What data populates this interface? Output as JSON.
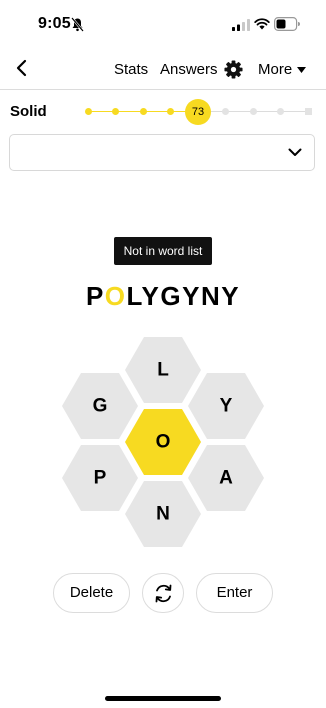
{
  "status_bar": {
    "time": "9:05",
    "icons": [
      "bell-muted-icon",
      "signal-icon",
      "wifi-icon",
      "battery-icon"
    ]
  },
  "nav": {
    "back_icon": "back-icon",
    "stats_label": "Stats",
    "answers_label": "Answers",
    "settings_icon": "gear-icon",
    "more_label": "More",
    "more_icon": "caret-down-icon"
  },
  "progress": {
    "rank": "Solid",
    "score": "73",
    "steps_total": 9,
    "steps_reached": 5,
    "fraction": 0.5
  },
  "word_list": {
    "value": "",
    "toggle_icon": "chevron-down-icon"
  },
  "toast": {
    "message": "Not in word list"
  },
  "input_word": {
    "text": "POLYGYNY",
    "center_letter": "O"
  },
  "hive": {
    "center": "O",
    "top": "L",
    "upper_left": "G",
    "upper_right": "Y",
    "lower_left": "P",
    "lower_right": "A",
    "bottom": "N"
  },
  "actions": {
    "delete_label": "Delete",
    "shuffle_icon": "shuffle-icon",
    "enter_label": "Enter"
  },
  "colors": {
    "accent": "#f7da21",
    "cell": "#e6e6e6",
    "text": "#000000"
  }
}
